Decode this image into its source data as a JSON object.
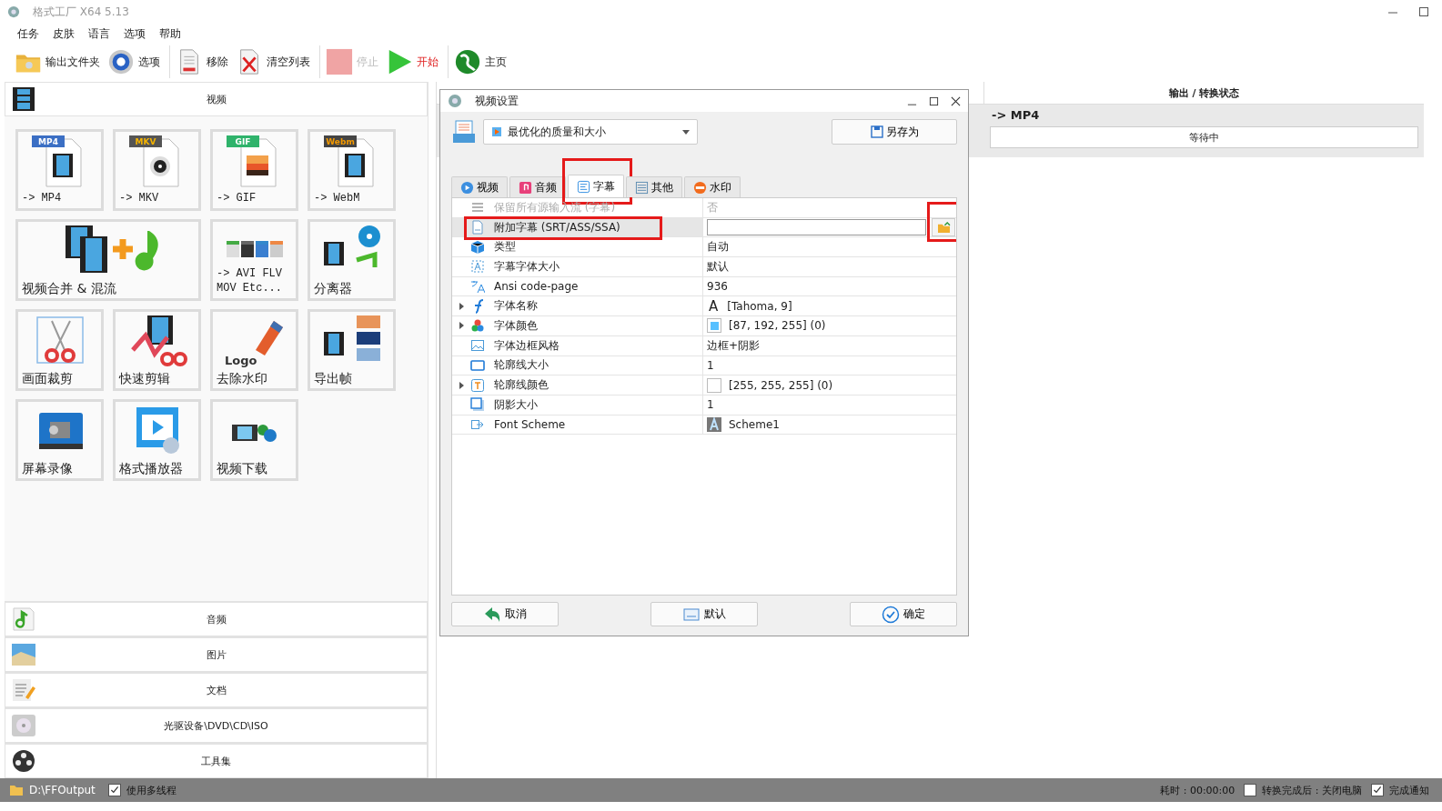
{
  "window": {
    "title": "格式工厂 X64 5.13"
  },
  "menu": [
    "任务",
    "皮肤",
    "语言",
    "选项",
    "帮助"
  ],
  "toolbar": [
    {
      "items": [
        {
          "label": "输出文件夹",
          "kind": "folder",
          "disabled": false
        },
        {
          "label": "选项",
          "kind": "gear",
          "disabled": false
        }
      ]
    },
    {
      "items": [
        {
          "label": "移除",
          "kind": "remove",
          "disabled": false
        },
        {
          "label": "清空列表",
          "kind": "clear",
          "disabled": false
        }
      ]
    },
    {
      "items": [
        {
          "label": "停止",
          "kind": "stop",
          "disabled": true
        },
        {
          "label": "开始",
          "kind": "start",
          "disabled": false
        }
      ]
    },
    {
      "items": [
        {
          "label": "主页",
          "kind": "home",
          "disabled": false
        }
      ]
    }
  ],
  "sidebar": {
    "header": "视频",
    "tiles": [
      {
        "lines": [
          "-> MP4"
        ],
        "kind": "mp4",
        "badge": "MP4",
        "wide": false
      },
      {
        "lines": [
          "-> MKV"
        ],
        "kind": "mkv",
        "badge": "MKV",
        "wide": false
      },
      {
        "lines": [
          "-> GIF"
        ],
        "kind": "gif",
        "badge": "GIF",
        "wide": false
      },
      {
        "lines": [
          "-> WebM"
        ],
        "kind": "webm",
        "badge": "Webm",
        "wide": false
      },
      {
        "lines": [
          "视频合并 & 混流"
        ],
        "kind": "merge",
        "wide": true
      },
      {
        "lines": [
          "-> AVI FLV",
          "MOV Etc..."
        ],
        "kind": "formats",
        "wide": false
      },
      {
        "lines": [
          "分离器"
        ],
        "kind": "splitter",
        "wide": false
      },
      {
        "lines": [
          "画面裁剪"
        ],
        "kind": "crop",
        "wide": false
      },
      {
        "lines": [
          "快速剪辑"
        ],
        "kind": "clip",
        "wide": false
      },
      {
        "lines": [
          "去除水印"
        ],
        "kind": "logo",
        "badge": "Logo",
        "wide": false
      },
      {
        "lines": [
          "导出帧"
        ],
        "kind": "frames",
        "wide": false
      },
      {
        "lines": [
          "屏幕录像"
        ],
        "kind": "record",
        "wide": false
      },
      {
        "lines": [
          "格式播放器"
        ],
        "kind": "player",
        "wide": false
      },
      {
        "lines": [
          "视频下载"
        ],
        "kind": "download",
        "wide": false
      }
    ],
    "categories": [
      {
        "label": "音频",
        "kind": "audio"
      },
      {
        "label": "图片",
        "kind": "image"
      },
      {
        "label": "文档",
        "kind": "document"
      },
      {
        "label": "光驱设备\\DVD\\CD\\ISO",
        "kind": "disc"
      },
      {
        "label": "工具集",
        "kind": "tools"
      }
    ]
  },
  "file_list": {
    "column_2": "输出 / 转换状态",
    "rows": [
      {
        "output": "-> MP4",
        "status": "等待中"
      }
    ]
  },
  "dialog": {
    "title": "视频设置",
    "profile": "最优化的质量和大小",
    "save_as": "另存为",
    "tabs": [
      {
        "label": "视频",
        "kind": "video",
        "selected": false,
        "highlighted": false
      },
      {
        "label": "音频",
        "kind": "audio",
        "selected": false,
        "highlighted": false
      },
      {
        "label": "字幕",
        "kind": "subtitle",
        "selected": true,
        "highlighted": true
      },
      {
        "label": "其他",
        "kind": "other",
        "selected": false,
        "highlighted": false
      },
      {
        "label": "水印",
        "kind": "watermark",
        "selected": false,
        "highlighted": false
      }
    ],
    "properties": [
      {
        "name": "保留所有源输入流 (字幕)",
        "value": "否",
        "kind": "text",
        "disabled": true,
        "selected": false,
        "expander": false,
        "highlighted": false
      },
      {
        "name": "附加字幕 (SRT/ASS/SSA)",
        "kind": "file",
        "disabled": false,
        "selected": true,
        "expander": false,
        "highlighted": true
      },
      {
        "name": "类型",
        "value": "自动",
        "kind": "text",
        "disabled": false,
        "selected": false,
        "expander": false,
        "highlighted": false
      },
      {
        "name": "字幕字体大小",
        "value": "默认",
        "kind": "text",
        "disabled": false,
        "selected": false,
        "expander": false,
        "highlighted": false
      },
      {
        "name": "Ansi code-page",
        "value": "936",
        "kind": "text",
        "disabled": false,
        "selected": false,
        "expander": false,
        "highlighted": false
      },
      {
        "name": "字体名称",
        "value": "[Tahoma, 9]",
        "glyph": "A",
        "kind": "font",
        "disabled": false,
        "selected": false,
        "expander": true,
        "highlighted": false
      },
      {
        "name": "字体颜色",
        "value": "[87, 192, 255] (0)",
        "color": "#57c0ff",
        "kind": "color",
        "disabled": false,
        "selected": false,
        "expander": true,
        "highlighted": false
      },
      {
        "name": "字体边框风格",
        "value": "边框+阴影",
        "kind": "text",
        "disabled": false,
        "selected": false,
        "expander": false,
        "highlighted": false
      },
      {
        "name": "轮廓线大小",
        "value": "1",
        "kind": "text",
        "disabled": false,
        "selected": false,
        "expander": false,
        "highlighted": false
      },
      {
        "name": "轮廓线颜色",
        "value": "[255, 255, 255] (0)",
        "color": "#ffffff",
        "kind": "color",
        "disabled": false,
        "selected": false,
        "expander": true,
        "highlighted": false
      },
      {
        "name": "阴影大小",
        "value": "1",
        "kind": "text",
        "disabled": false,
        "selected": false,
        "expander": false,
        "highlighted": false
      },
      {
        "name": "Font Scheme",
        "value": "Scheme1",
        "kind": "scheme",
        "disabled": false,
        "selected": false,
        "expander": false,
        "highlighted": false
      }
    ],
    "buttons": [
      {
        "label": "取消",
        "kind": "cancel"
      },
      {
        "label": "默认",
        "kind": "default"
      },
      {
        "label": "确定",
        "kind": "ok"
      }
    ]
  },
  "status_bar": {
    "output_folder": "D:\\FFOutput",
    "multithread": {
      "label": "使用多线程",
      "checked": true
    },
    "elapsed": "耗时 : 00:00:00",
    "shutdown": {
      "label": "转换完成后 : 关闭电脑",
      "checked": false
    },
    "notify": {
      "label": "完成通知",
      "checked": true
    }
  }
}
